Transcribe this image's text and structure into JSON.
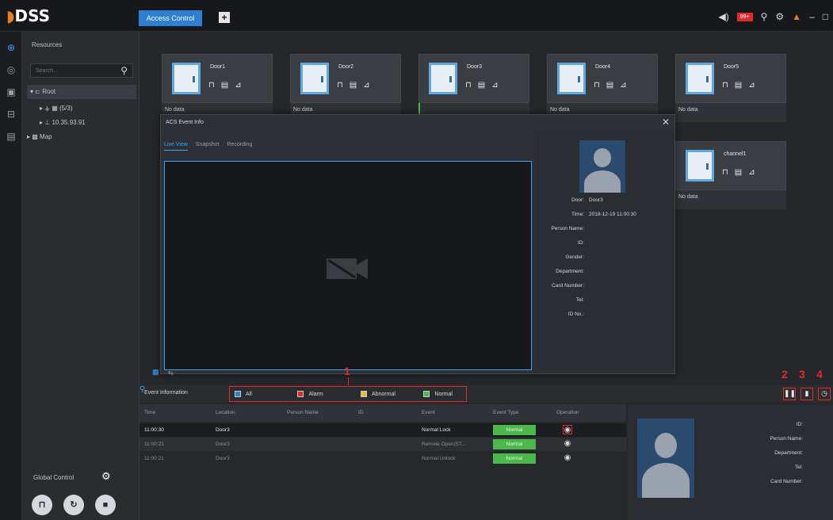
{
  "app": {
    "logo": "DSS",
    "active_tab": "Access Control",
    "add_tab": "+",
    "alarm_badge": "99+"
  },
  "resources": {
    "title": "Resources",
    "search_placeholder": "Search...",
    "tree": [
      {
        "label": "Root"
      },
      {
        "label": "(5/3)"
      },
      {
        "label": "10.35.93.91"
      },
      {
        "label": "Map"
      }
    ],
    "global_control": "Global Control"
  },
  "doors": [
    {
      "name": "Door1",
      "status": "No data"
    },
    {
      "name": "Door2",
      "status": "No data"
    },
    {
      "name": "Door3",
      "status": ""
    },
    {
      "name": "Door4",
      "status": "No data"
    },
    {
      "name": "Door5",
      "status": "No data"
    },
    {
      "name": "channel1",
      "status": "No data"
    }
  ],
  "acs_event": {
    "title": "ACS Event Info",
    "tabs": [
      "Live View",
      "Snapshot",
      "Recording"
    ],
    "info": {
      "door_label": "Door:",
      "door_value": "Door3",
      "time_label": "Time:",
      "time_value": "2018-12-19 11:00:30",
      "person_name_label": "Person Name:",
      "id_label": "ID:",
      "gender_label": "Gender:",
      "department_label": "Department:",
      "card_number_label": "Card Number:",
      "tel_label": "Tel:",
      "id_no_label": "ID No.:"
    }
  },
  "annotations": [
    "1",
    "2",
    "3",
    "4"
  ],
  "event_info": {
    "title": "Event Information",
    "filters": [
      {
        "label": "All",
        "color": "#2d7fd3"
      },
      {
        "label": "Alarm",
        "color": "#e02b2b"
      },
      {
        "label": "Abnormal",
        "color": "#e6c02b"
      },
      {
        "label": "Normal",
        "color": "#4cb84c"
      }
    ],
    "columns": [
      "Time",
      "Location",
      "Person Name",
      "ID",
      "Event",
      "Event Type",
      "Operation"
    ],
    "rows": [
      {
        "time": "11:00:30",
        "location": "Door3",
        "person": "",
        "id": "",
        "event": "Normal Lock",
        "type": "Normal"
      },
      {
        "time": "11:00:21",
        "location": "Door3",
        "person": "",
        "id": "",
        "event": "Remote Open(ST...",
        "type": "Normal"
      },
      {
        "time": "11:00:21",
        "location": "Door3",
        "person": "",
        "id": "",
        "event": "Normal Unlock",
        "type": "Normal"
      }
    ]
  },
  "person_panel": {
    "id_label": "ID:",
    "person_name_label": "Person Name:",
    "department_label": "Department:",
    "tel_label": "Tel:",
    "card_number_label": "Card Number:"
  }
}
